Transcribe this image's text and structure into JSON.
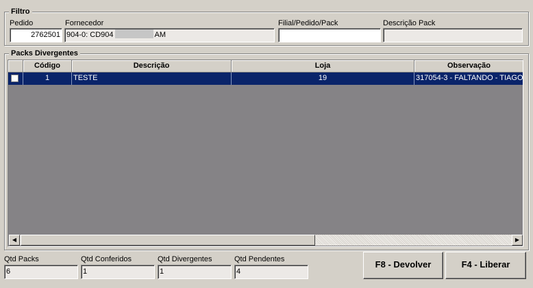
{
  "filtro": {
    "title": "Filtro",
    "pedido_label": "Pedido",
    "pedido_value": "2762501",
    "fornecedor_label": "Fornecedor",
    "fornecedor_prefix": "904-0: CD904",
    "fornecedor_suffix": "AM",
    "filial_label": "Filial/Pedido/Pack",
    "filial_value": "",
    "descricao_pack_label": "Descrição Pack",
    "descricao_pack_value": ""
  },
  "packs": {
    "title": "Packs Divergentes",
    "columns": [
      "",
      "Código",
      "Descrição",
      "Loja",
      "Observação"
    ],
    "rows": [
      {
        "codigo": "1",
        "descricao": "TESTE",
        "loja": "19",
        "observacao": "317054-3 - FALTANDO - TIAGO",
        "selected": true
      }
    ]
  },
  "footer": {
    "qtd_packs_label": "Qtd Packs",
    "qtd_packs_value": "6",
    "qtd_conferidos_label": "Qtd Conferidos",
    "qtd_conferidos_value": "1",
    "qtd_divergentes_label": "Qtd Divergentes",
    "qtd_divergentes_value": "1",
    "qtd_pendentes_label": "Qtd Pendentes",
    "qtd_pendentes_value": "4",
    "devolver_label": "F8 - Devolver",
    "liberar_label": "F4 - Liberar"
  },
  "colors": {
    "window_bg": "#d4d0c8",
    "selection": "#0a246a",
    "grid_bg": "#858386"
  }
}
